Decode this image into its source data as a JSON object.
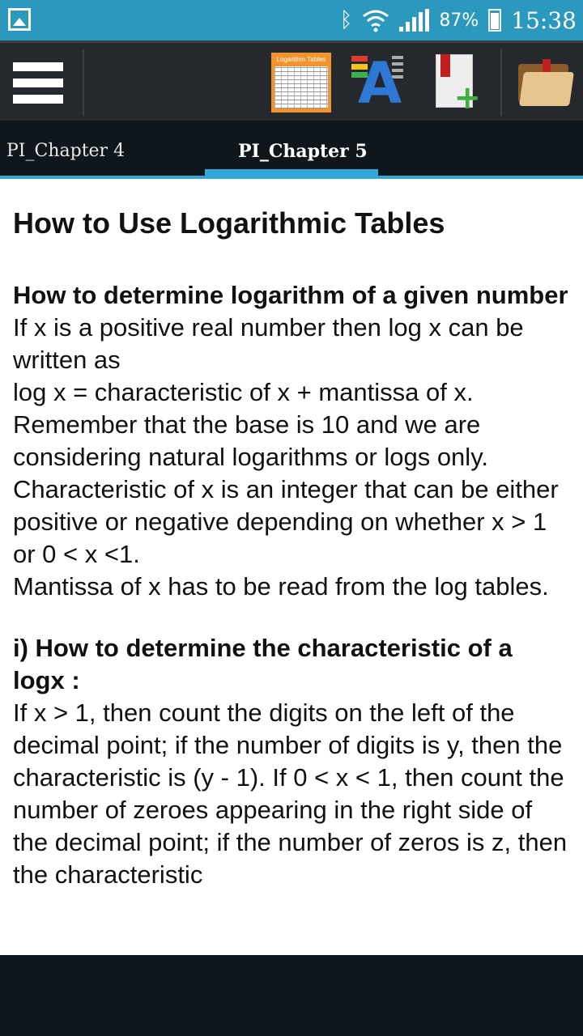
{
  "status_bar": {
    "battery_percent": "87%",
    "time": "15:38",
    "icons": [
      "gallery-icon",
      "bluetooth-icon",
      "wifi-icon",
      "signal-icon",
      "battery-icon"
    ]
  },
  "toolbar": {
    "log_tables_label": "Logarithm Tables",
    "icons": [
      "menu-icon",
      "logarithm-tables-icon",
      "font-size-icon",
      "add-bookmark-icon",
      "bookmarks-folder-icon"
    ]
  },
  "tabs": [
    {
      "label": "PI_Chapter 4",
      "active": false
    },
    {
      "label": "PI_Chapter 5",
      "active": true
    }
  ],
  "article": {
    "title": "How to Use Logarithmic Tables",
    "section1_heading": "How to determine logarithm of a given number",
    "section1_body": [
      "If x is a positive real number then log x can be written as",
      "log x = characteristic of x + mantissa of x.",
      "Remember that the base is 10 and we are considering natural logarithms or logs only.",
      "Characteristic of x is an integer that can be either positive or negative depending on whether x > 1 or 0 < x <1.",
      "Mantissa of x has to be read from the log tables."
    ],
    "section2_heading": "i) How to determine the characteristic of a logx :",
    "section2_body": "If x > 1, then count the digits on the left of the decimal point; if the number of digits is y, then the characteristic is (y - 1). If 0 < x < 1, then count the number of zeroes appearing in the right side of the decimal point; if the number of zeros is z, then the characteristic"
  },
  "colors": {
    "status_bar": "#2b98bd",
    "action_bar": "#25292d",
    "tab_bar": "#0f171d",
    "accent": "#35a6d8"
  }
}
